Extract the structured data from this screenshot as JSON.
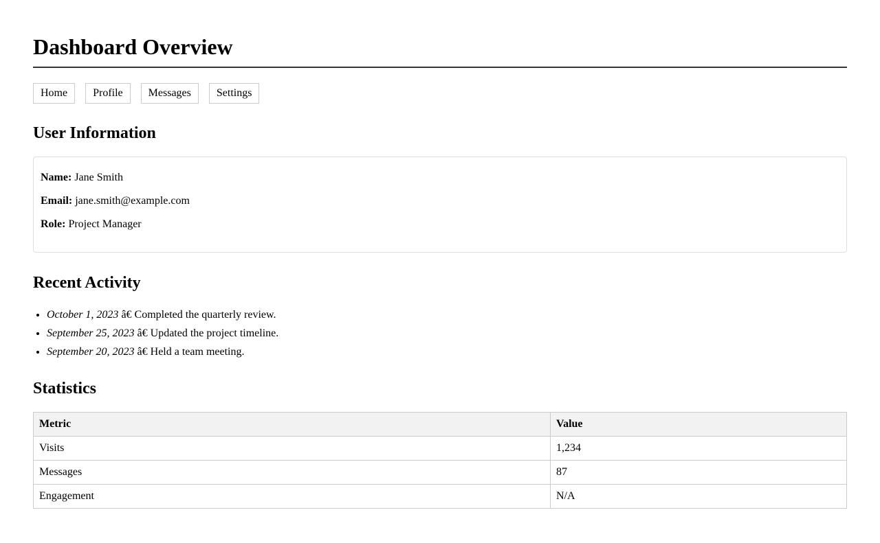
{
  "header": {
    "title": "Dashboard Overview"
  },
  "nav": {
    "items": [
      {
        "label": "Home"
      },
      {
        "label": "Profile"
      },
      {
        "label": "Messages"
      },
      {
        "label": "Settings"
      }
    ]
  },
  "user_info": {
    "heading": "User Information",
    "name_label": "Name:",
    "name_value": "Jane Smith",
    "email_label": "Email:",
    "email_value": "jane.smith@example.com",
    "role_label": "Role:",
    "role_value": "Project Manager"
  },
  "activity": {
    "heading": "Recent Activity",
    "items": [
      {
        "date": "October 1, 2023",
        "separator": "â€",
        "text": "Completed the quarterly review."
      },
      {
        "date": "September 25, 2023",
        "separator": "â€",
        "text": "Updated the project timeline."
      },
      {
        "date": "September 20, 2023",
        "separator": "â€",
        "text": "Held a team meeting."
      }
    ]
  },
  "statistics": {
    "heading": "Statistics",
    "columns": [
      "Metric",
      "Value"
    ],
    "rows": [
      {
        "metric": "Visits",
        "value": "1,234"
      },
      {
        "metric": "Messages",
        "value": "87"
      },
      {
        "metric": "Engagement",
        "value": "N/A"
      }
    ]
  }
}
